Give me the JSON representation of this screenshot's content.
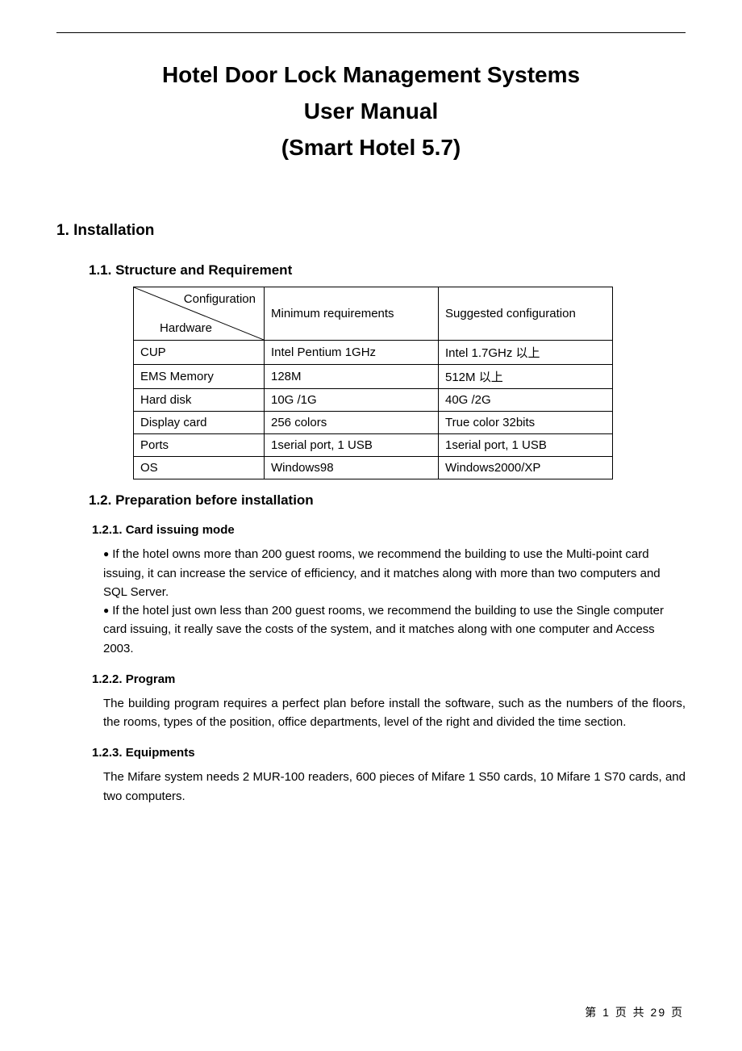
{
  "title_line1": "Hotel Door Lock Management Systems",
  "title_line2": "User Manual",
  "title_line3": "(Smart Hotel 5.7)",
  "h1": "1. Installation",
  "h2_11": "1.1. Structure and Requirement",
  "table": {
    "diag_top": "Configuration",
    "diag_bot": "Hardware",
    "col2": "Minimum requirements",
    "col3": "Suggested configuration",
    "rows": [
      {
        "c1": "CUP",
        "c2": "Intel Pentium 1GHz",
        "c3": "Intel  1.7GHz 以上"
      },
      {
        "c1": "EMS Memory",
        "c2": "128M",
        "c3": "512M 以上"
      },
      {
        "c1": "Hard disk",
        "c2": "10G /1G",
        "c3": "40G /2G"
      },
      {
        "c1": "Display card",
        "c2": "256 colors",
        "c3": "True color 32bits"
      },
      {
        "c1": "Ports",
        "c2": "1serial port, 1 USB",
        "c3": "1serial port, 1 USB"
      },
      {
        "c1": "OS",
        "c2": "Windows98",
        "c3": "Windows2000/XP"
      }
    ]
  },
  "h2_12": "1.2. Preparation before installation",
  "h3_121": "1.2.1. Card issuing mode",
  "p_121a": "If the hotel owns more than 200 guest rooms, we recommend the building to use the Multi-point card issuing, it can increase the service of efficiency, and it matches along with more than two computers and SQL Server.",
  "p_121b": "If the hotel just own less than 200 guest rooms, we recommend the building to use the Single computer card issuing, it really save the costs of the system, and it matches along with one computer and Access 2003.",
  "h3_122": "1.2.2. Program",
  "p_122": "The building program requires a perfect plan before install the software, such as the numbers of the floors, the rooms, types of the position, office departments, level of the right and divided the time section.",
  "h3_123": "1.2.3. Equipments",
  "p_123": "The Mifare system needs 2 MUR-100 readers, 600 pieces of Mifare 1 S50 cards, 10 Mifare 1 S70 cards, and two computers.",
  "footer": "第 1 页 共 29 页"
}
